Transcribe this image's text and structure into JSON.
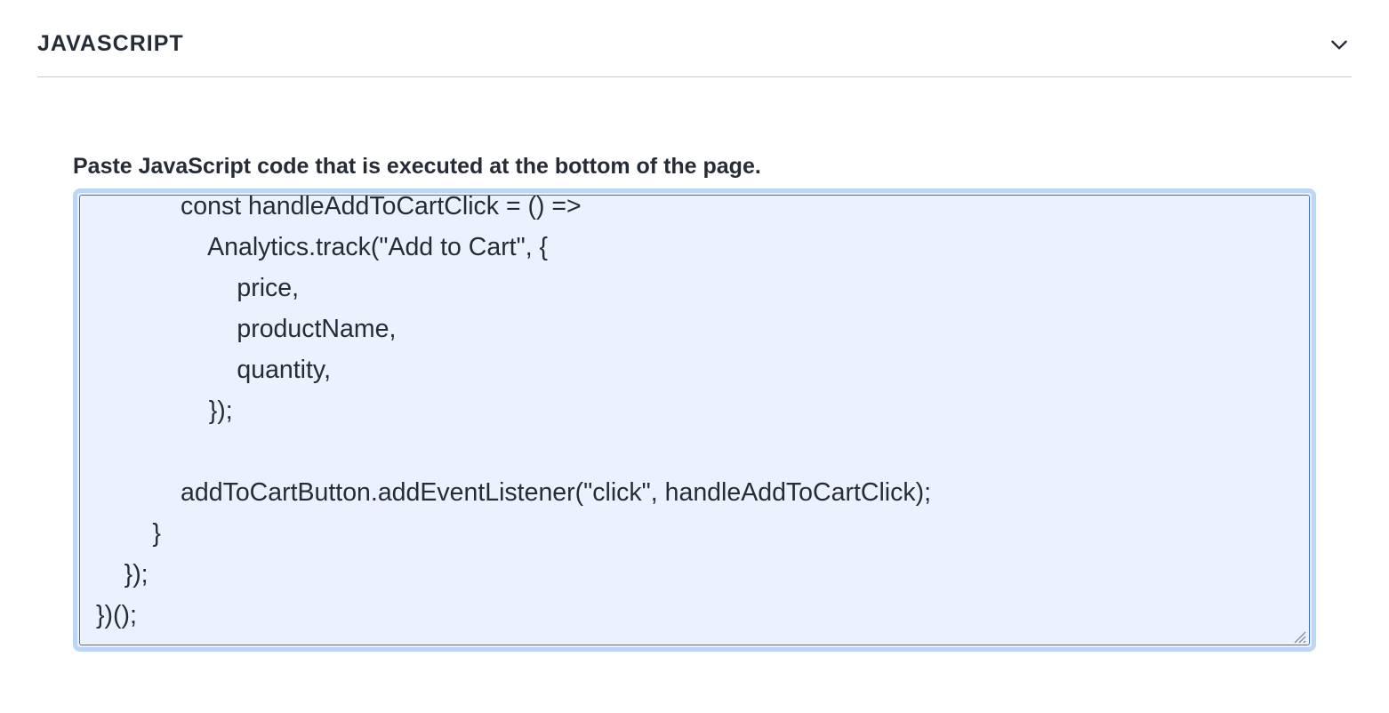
{
  "section": {
    "title": "JAVASCRIPT",
    "description": "Paste JavaScript code that is executed at the bottom of the page.",
    "code": "            const handleAddToCartClick = () =>\n                Analytics.track(\"Add to Cart\", {\n                    price,\n                    productName,\n                    quantity,\n                });\n\n            addToCartButton.addEventListener(\"click\", handleAddToCartClick);\n        }\n    });\n})();"
  }
}
